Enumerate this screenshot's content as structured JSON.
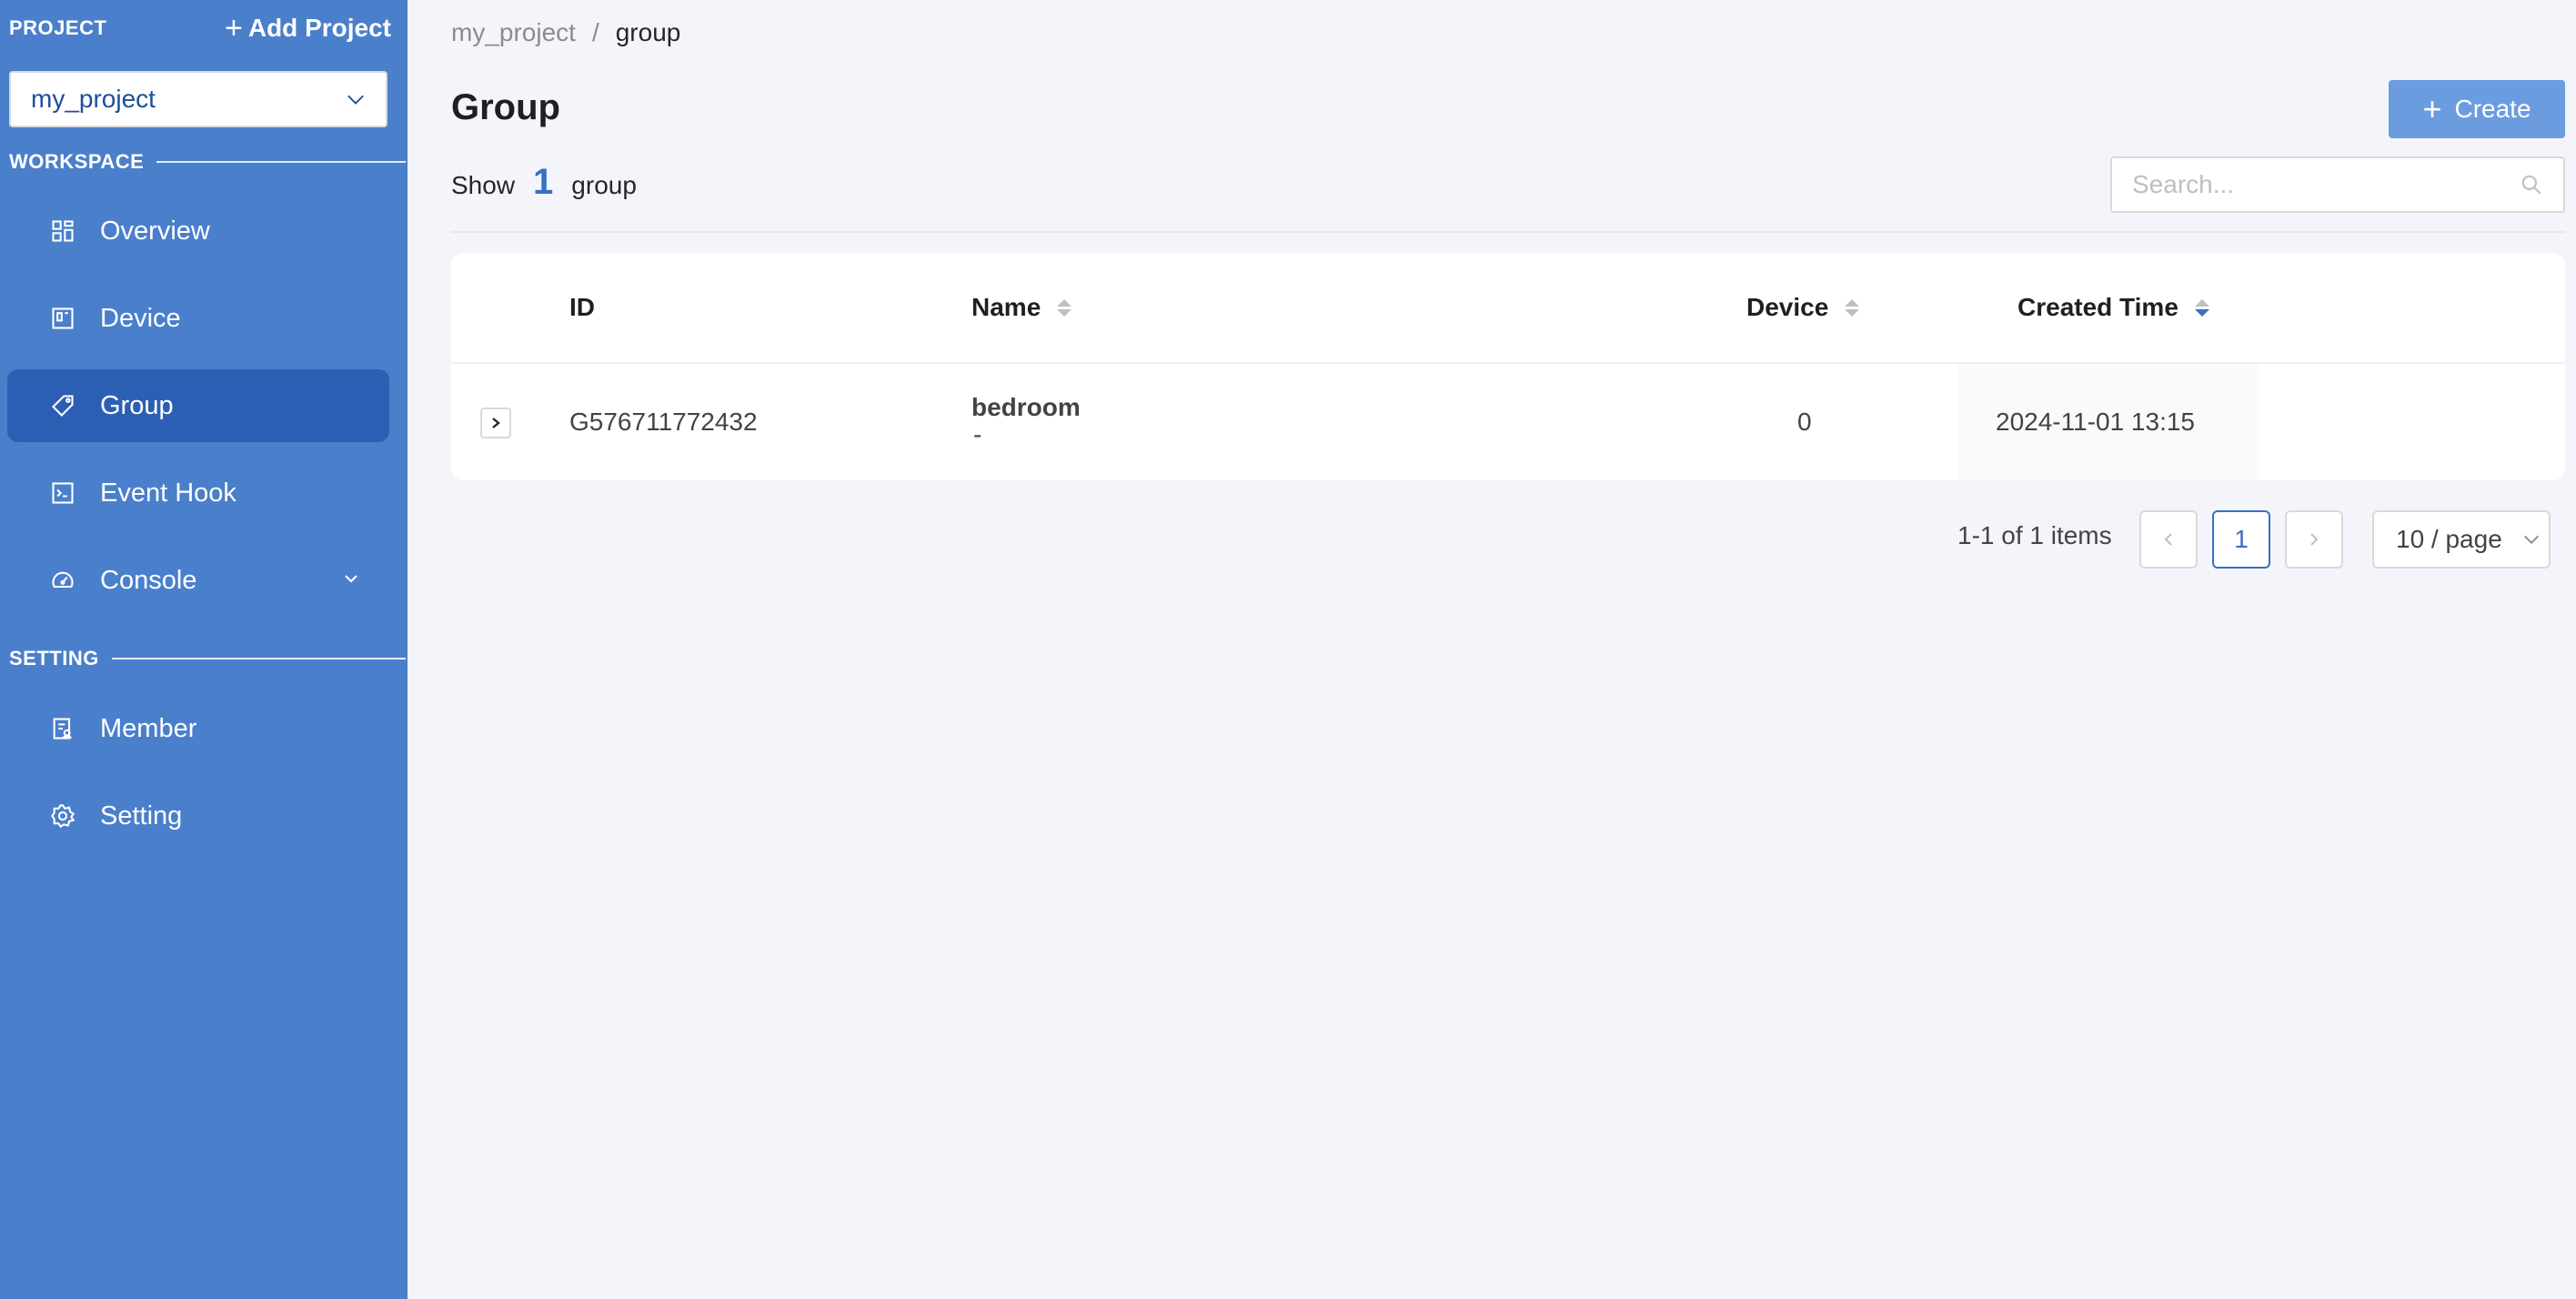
{
  "sidebar": {
    "project_label": "PROJECT",
    "add_project_label": "Add Project",
    "selected_project": "my_project",
    "workspace_label": "WORKSPACE",
    "setting_label": "SETTING",
    "workspace_items": [
      {
        "label": "Overview",
        "icon": "grid-icon"
      },
      {
        "label": "Device",
        "icon": "device-icon"
      },
      {
        "label": "Group",
        "icon": "tag-icon",
        "active": true
      },
      {
        "label": "Event Hook",
        "icon": "terminal-icon"
      },
      {
        "label": "Console",
        "icon": "dashboard-icon",
        "has_submenu": true
      }
    ],
    "setting_items": [
      {
        "label": "Member",
        "icon": "member-icon"
      },
      {
        "label": "Setting",
        "icon": "gear-icon"
      }
    ]
  },
  "breadcrumb": {
    "items": [
      "my_project",
      "group"
    ],
    "separator": "/"
  },
  "page": {
    "title": "Group",
    "create_label": "Create",
    "show_prefix": "Show",
    "count": "1",
    "show_suffix": "group",
    "search_placeholder": "Search..."
  },
  "table": {
    "columns": [
      "ID",
      "Name",
      "Device",
      "Created Time"
    ],
    "rows": [
      {
        "id": "G576711772432",
        "name": "bedroom",
        "description": "-",
        "device": "0",
        "created_time": "2024-11-01 13:15"
      }
    ]
  },
  "pagination": {
    "summary": "1-1 of 1 items",
    "current_page": "1",
    "page_size": "10 / page"
  },
  "colors": {
    "sidebar_bg": "#4a7fcb",
    "active_item_bg": "#2b5fb3",
    "accent": "#3a6fc2",
    "create_button": "#6b9ce0",
    "page_bg": "#f3f5fa"
  }
}
